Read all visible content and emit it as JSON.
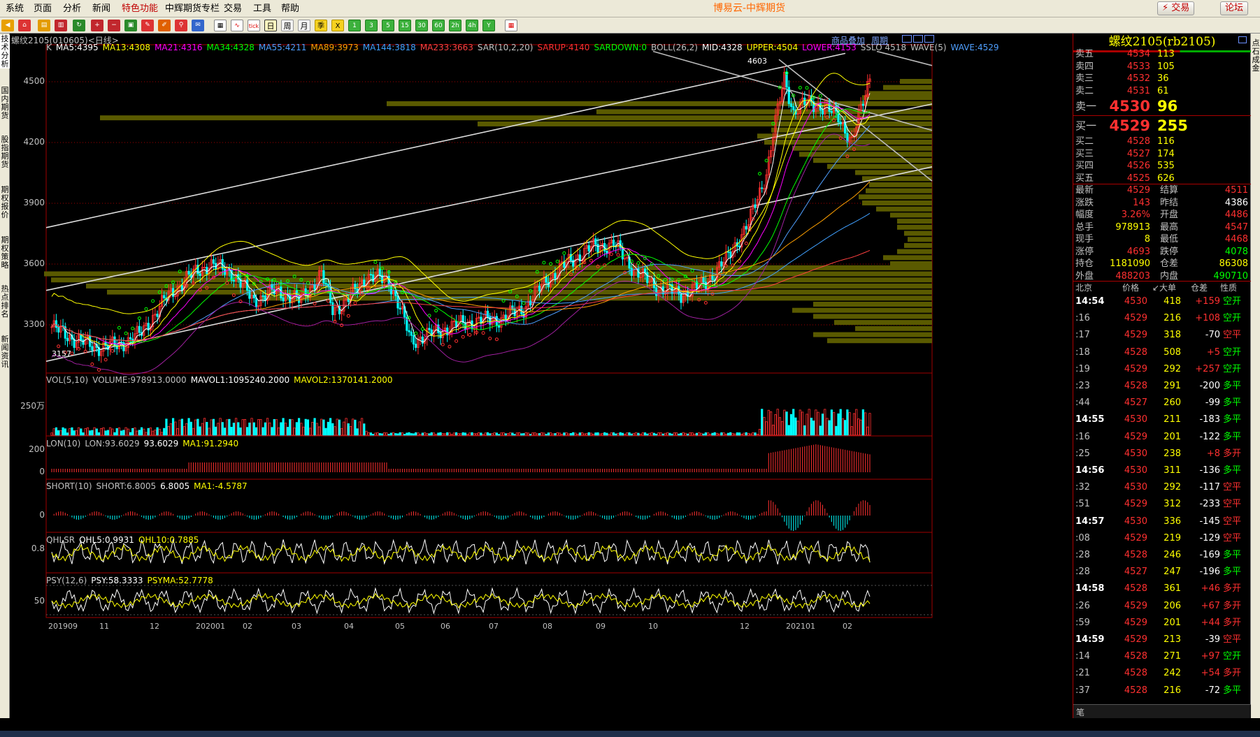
{
  "menu": {
    "items": [
      "系统",
      "页面",
      "分析",
      "新闻",
      "特色功能",
      "中辉期货专栏",
      "交易",
      "工具",
      "帮助"
    ],
    "special_index": 4
  },
  "app_title": "博易云-中辉期货",
  "top_buttons": {
    "trade": "⚡ 交易",
    "forum": "论坛"
  },
  "toolbar": {
    "periods": [
      "日",
      "周",
      "月",
      "季",
      "X",
      "1",
      "3",
      "5",
      "15",
      "30",
      "60",
      "2h",
      "4h",
      "Y"
    ],
    "active_period": "日"
  },
  "left_tabs": [
    "技术分析",
    "国内期货",
    "股指期货",
    "期权报价",
    "期权策略",
    "热点排名",
    "新闻资讯"
  ],
  "right_tab": "点石成金",
  "chart": {
    "title": "螺纹2105(010605)<日线>",
    "links": {
      "overlay": "商品叠加",
      "period": "周期"
    },
    "period_label": "日线",
    "main_head": [
      {
        "t": "K",
        "c": "#c0c0c0"
      },
      {
        "t": "MA5:4395",
        "c": "#ffffff"
      },
      {
        "t": "MA13:4308",
        "c": "#ffff00"
      },
      {
        "t": "MA21:4316",
        "c": "#ff00ff"
      },
      {
        "t": "MA34:4328",
        "c": "#00ff00"
      },
      {
        "t": "MA55:4211",
        "c": "#4f9fff"
      },
      {
        "t": "MA89:3973",
        "c": "#ffa000"
      },
      {
        "t": "MA144:3818",
        "c": "#40a0ff"
      },
      {
        "t": "MA233:3663",
        "c": "#ff4040"
      },
      {
        "t": "SAR(10,2,20)",
        "c": "#c0c0c0"
      },
      {
        "t": "SARUP:4140",
        "c": "#ff3030"
      },
      {
        "t": "SARDOWN:0",
        "c": "#00ff00"
      },
      {
        "t": "BOLL(26,2)",
        "c": "#c0c0c0"
      },
      {
        "t": "MID:4328",
        "c": "#ffffff"
      },
      {
        "t": "UPPER:4504",
        "c": "#ffff00"
      },
      {
        "t": "LOWER:4153",
        "c": "#ff00ff"
      },
      {
        "t": "SSLO 4518",
        "c": "#c0c0c0"
      },
      {
        "t": "WAVE(5)",
        "c": "#c0c0c0"
      },
      {
        "t": "WAVE:4529",
        "c": "#4f9fff"
      }
    ],
    "main_yticks": [
      "4500",
      "4200",
      "3900",
      "3600",
      "3300"
    ],
    "main_annotations": {
      "high": "4603",
      "low": "3157"
    },
    "vol_head": [
      {
        "t": "VOL(5,10)",
        "c": "#c0c0c0"
      },
      {
        "t": "VOLUME:978913.0000",
        "c": "#c0c0c0"
      },
      {
        "t": "MAVOL1:1095240.2000",
        "c": "#ffffff"
      },
      {
        "t": "MAVOL2:1370141.2000",
        "c": "#ffff00"
      }
    ],
    "vol_ytick": "250万",
    "lon_head": [
      {
        "t": "LON(10)",
        "c": "#c0c0c0"
      },
      {
        "t": "LON:93.6029",
        "c": "#c0c0c0"
      },
      {
        "t": "93.6029",
        "c": "#ffffff"
      },
      {
        "t": "MA1:91.2940",
        "c": "#ffff00"
      }
    ],
    "lon_yticks": [
      "200",
      "0"
    ],
    "short_head": [
      {
        "t": "SHORT(10)",
        "c": "#c0c0c0"
      },
      {
        "t": "SHORT:6.8005",
        "c": "#c0c0c0"
      },
      {
        "t": "6.8005",
        "c": "#ffffff"
      },
      {
        "t": "MA1:-4.5787",
        "c": "#ffff00"
      }
    ],
    "short_ytick": "0",
    "qhlsr_head": [
      {
        "t": "QHLSR",
        "c": "#c0c0c0"
      },
      {
        "t": "QHL5:0.9931",
        "c": "#ffffff"
      },
      {
        "t": "QHL10:0.7885",
        "c": "#ffff00"
      }
    ],
    "qhlsr_ytick": "0.8",
    "psy_head": [
      {
        "t": "PSY(12,6)",
        "c": "#c0c0c0"
      },
      {
        "t": "PSY:58.3333",
        "c": "#ffffff"
      },
      {
        "t": "PSYMA:52.7778",
        "c": "#ffff00"
      }
    ],
    "psy_ytick": "50",
    "xticks": [
      "201909",
      "11",
      "12",
      "202001",
      "02",
      "03",
      "04",
      "05",
      "06",
      "07",
      "08",
      "09",
      "10",
      "12",
      "202101",
      "02"
    ]
  },
  "chart_data": {
    "type": "candlestick",
    "title": "螺纹2105(010605)<日线>",
    "x_range": [
      "201909",
      "202102"
    ],
    "y_range": [
      3157,
      4603
    ],
    "key_points": [
      {
        "x": "201909",
        "close": 3280
      },
      {
        "x": "201910",
        "close": 3157
      },
      {
        "x": "202001",
        "close": 3550
      },
      {
        "x": "202003",
        "close": 3450
      },
      {
        "x": "202005",
        "close": 3500
      },
      {
        "x": "202005",
        "close": 3200
      },
      {
        "x": "202007",
        "close": 3420
      },
      {
        "x": "202009",
        "close": 3720
      },
      {
        "x": "202010",
        "close": 3500
      },
      {
        "x": "202011",
        "close": 3700
      },
      {
        "x": "202012",
        "close": 4603
      },
      {
        "x": "202101",
        "close": 4400
      },
      {
        "x": "202102",
        "close": 4200
      },
      {
        "x": "202102",
        "close": 4529
      }
    ]
  },
  "quote": {
    "title": "螺纹2105(rb2105)",
    "asks": [
      {
        "label": "卖五",
        "price": "4534",
        "vol": "113"
      },
      {
        "label": "卖四",
        "price": "4533",
        "vol": "105"
      },
      {
        "label": "卖三",
        "price": "4532",
        "vol": "36"
      },
      {
        "label": "卖二",
        "price": "4531",
        "vol": "61"
      }
    ],
    "ask1": {
      "label": "卖一",
      "price": "4530",
      "vol": "96"
    },
    "bid1": {
      "label": "买一",
      "price": "4529",
      "vol": "255"
    },
    "bids": [
      {
        "label": "买二",
        "price": "4528",
        "vol": "116"
      },
      {
        "label": "买三",
        "price": "4527",
        "vol": "174"
      },
      {
        "label": "买四",
        "price": "4526",
        "vol": "535"
      },
      {
        "label": "买五",
        "price": "4525",
        "vol": "626"
      }
    ],
    "stats": [
      {
        "k1": "最新",
        "v1": "4529",
        "c1": "#ff3030",
        "k2": "结算",
        "v2": "4511",
        "c2": "#ff3030"
      },
      {
        "k1": "涨跌",
        "v1": "143",
        "c1": "#ff3030",
        "k2": "昨结",
        "v2": "4386",
        "c2": "#ffffff"
      },
      {
        "k1": "幅度",
        "v1": "3.26%",
        "c1": "#ff3030",
        "k2": "开盘",
        "v2": "4486",
        "c2": "#ff3030"
      },
      {
        "k1": "总手",
        "v1": "978913",
        "c1": "#ffff00",
        "k2": "最高",
        "v2": "4547",
        "c2": "#ff3030"
      },
      {
        "k1": "现手",
        "v1": "8",
        "c1": "#ffff00",
        "k2": "最低",
        "v2": "4468",
        "c2": "#ff3030"
      },
      {
        "k1": "涨停",
        "v1": "4693",
        "c1": "#ff3030",
        "k2": "跌停",
        "v2": "4078",
        "c2": "#00ff00"
      },
      {
        "k1": "持仓",
        "v1": "1181090",
        "c1": "#ffff00",
        "k2": "仓差",
        "v2": "86308",
        "c2": "#ffff00"
      },
      {
        "k1": "外盘",
        "v1": "488203",
        "c1": "#ff3030",
        "k2": "内盘",
        "v2": "490710",
        "c2": "#00ff00"
      }
    ],
    "ticks_header": {
      "loc": "北京",
      "price": "价格",
      "vol": "↙大单",
      "oi": "仓差",
      "nature": "性质"
    },
    "ticks": [
      {
        "t": "14:54",
        "full": true,
        "p": "4530",
        "v": "418",
        "o": "+159",
        "n": "空开",
        "up": false
      },
      {
        "t": ":16",
        "full": false,
        "p": "4529",
        "v": "216",
        "o": "+108",
        "n": "空开",
        "up": false
      },
      {
        "t": ":17",
        "full": false,
        "p": "4529",
        "v": "318",
        "o": "-70",
        "n": "空平",
        "up": true
      },
      {
        "t": ":18",
        "full": false,
        "p": "4528",
        "v": "508",
        "o": "+5",
        "n": "空开",
        "up": false
      },
      {
        "t": ":19",
        "full": false,
        "p": "4529",
        "v": "292",
        "o": "+257",
        "n": "空开",
        "up": false
      },
      {
        "t": ":23",
        "full": false,
        "p": "4528",
        "v": "291",
        "o": "-200",
        "n": "多平",
        "up": false
      },
      {
        "t": ":44",
        "full": false,
        "p": "4527",
        "v": "260",
        "o": "-99",
        "n": "多平",
        "up": false
      },
      {
        "t": "14:55",
        "full": true,
        "p": "4530",
        "v": "211",
        "o": "-183",
        "n": "多平",
        "up": false
      },
      {
        "t": ":16",
        "full": false,
        "p": "4529",
        "v": "201",
        "o": "-122",
        "n": "多平",
        "up": false
      },
      {
        "t": ":25",
        "full": false,
        "p": "4530",
        "v": "238",
        "o": "+8",
        "n": "多开",
        "up": true
      },
      {
        "t": "14:56",
        "full": true,
        "p": "4530",
        "v": "311",
        "o": "-136",
        "n": "多平",
        "up": false
      },
      {
        "t": ":32",
        "full": false,
        "p": "4530",
        "v": "292",
        "o": "-117",
        "n": "空平",
        "up": true
      },
      {
        "t": ":51",
        "full": false,
        "p": "4529",
        "v": "312",
        "o": "-233",
        "n": "空平",
        "up": true
      },
      {
        "t": "14:57",
        "full": true,
        "p": "4530",
        "v": "336",
        "o": "-145",
        "n": "空平",
        "up": true
      },
      {
        "t": ":08",
        "full": false,
        "p": "4529",
        "v": "219",
        "o": "-129",
        "n": "空平",
        "up": true
      },
      {
        "t": ":28",
        "full": false,
        "p": "4528",
        "v": "246",
        "o": "-169",
        "n": "多平",
        "up": false
      },
      {
        "t": ":28",
        "full": false,
        "p": "4527",
        "v": "247",
        "o": "-196",
        "n": "多平",
        "up": false
      },
      {
        "t": "14:58",
        "full": true,
        "p": "4528",
        "v": "361",
        "o": "+46",
        "n": "多开",
        "up": true
      },
      {
        "t": ":26",
        "full": false,
        "p": "4529",
        "v": "206",
        "o": "+67",
        "n": "多开",
        "up": true
      },
      {
        "t": ":59",
        "full": false,
        "p": "4529",
        "v": "201",
        "o": "+44",
        "n": "多开",
        "up": true
      },
      {
        "t": "14:59",
        "full": true,
        "p": "4529",
        "v": "213",
        "o": "-39",
        "n": "空平",
        "up": true
      },
      {
        "t": ":14",
        "full": false,
        "p": "4528",
        "v": "271",
        "o": "+97",
        "n": "空开",
        "up": false
      },
      {
        "t": ":21",
        "full": false,
        "p": "4528",
        "v": "242",
        "o": "+54",
        "n": "多开",
        "up": true
      },
      {
        "t": ":37",
        "full": false,
        "p": "4528",
        "v": "216",
        "o": "-72",
        "n": "多平",
        "up": false
      }
    ],
    "footer_tab": "笔"
  },
  "colors": {
    "up": "#ff3030",
    "down": "#00ffff",
    "grid": "#a00000",
    "volume_profile": "#5a5a00"
  }
}
